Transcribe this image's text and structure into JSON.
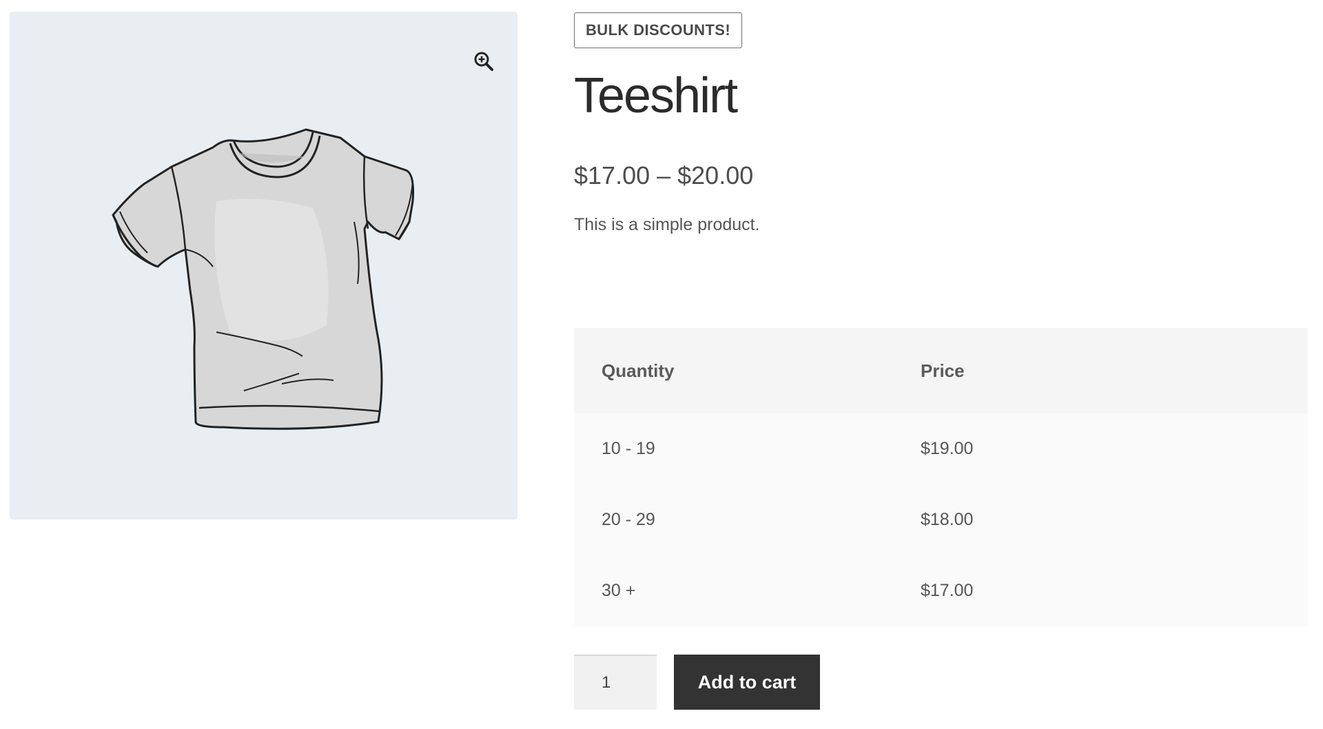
{
  "product": {
    "badge": "BULK DISCOUNTS!",
    "title": "Teeshirt",
    "price_range": "$17.00 – $20.00",
    "description": "This is a simple product.",
    "image_icon": "tshirt-illustration",
    "zoom_icon": "zoom-in-icon"
  },
  "pricing_table": {
    "headers": [
      "Quantity",
      "Price"
    ],
    "rows": [
      {
        "quantity": "10 - 19",
        "price": "$19.00"
      },
      {
        "quantity": "20 - 29",
        "price": "$18.00"
      },
      {
        "quantity": "30 +",
        "price": "$17.00"
      }
    ]
  },
  "cart": {
    "quantity_value": "1",
    "add_to_cart_label": "Add to cart"
  },
  "colors": {
    "gallery_bg": "#e9eef2",
    "button_bg": "#333333",
    "button_text": "#ffffff"
  }
}
